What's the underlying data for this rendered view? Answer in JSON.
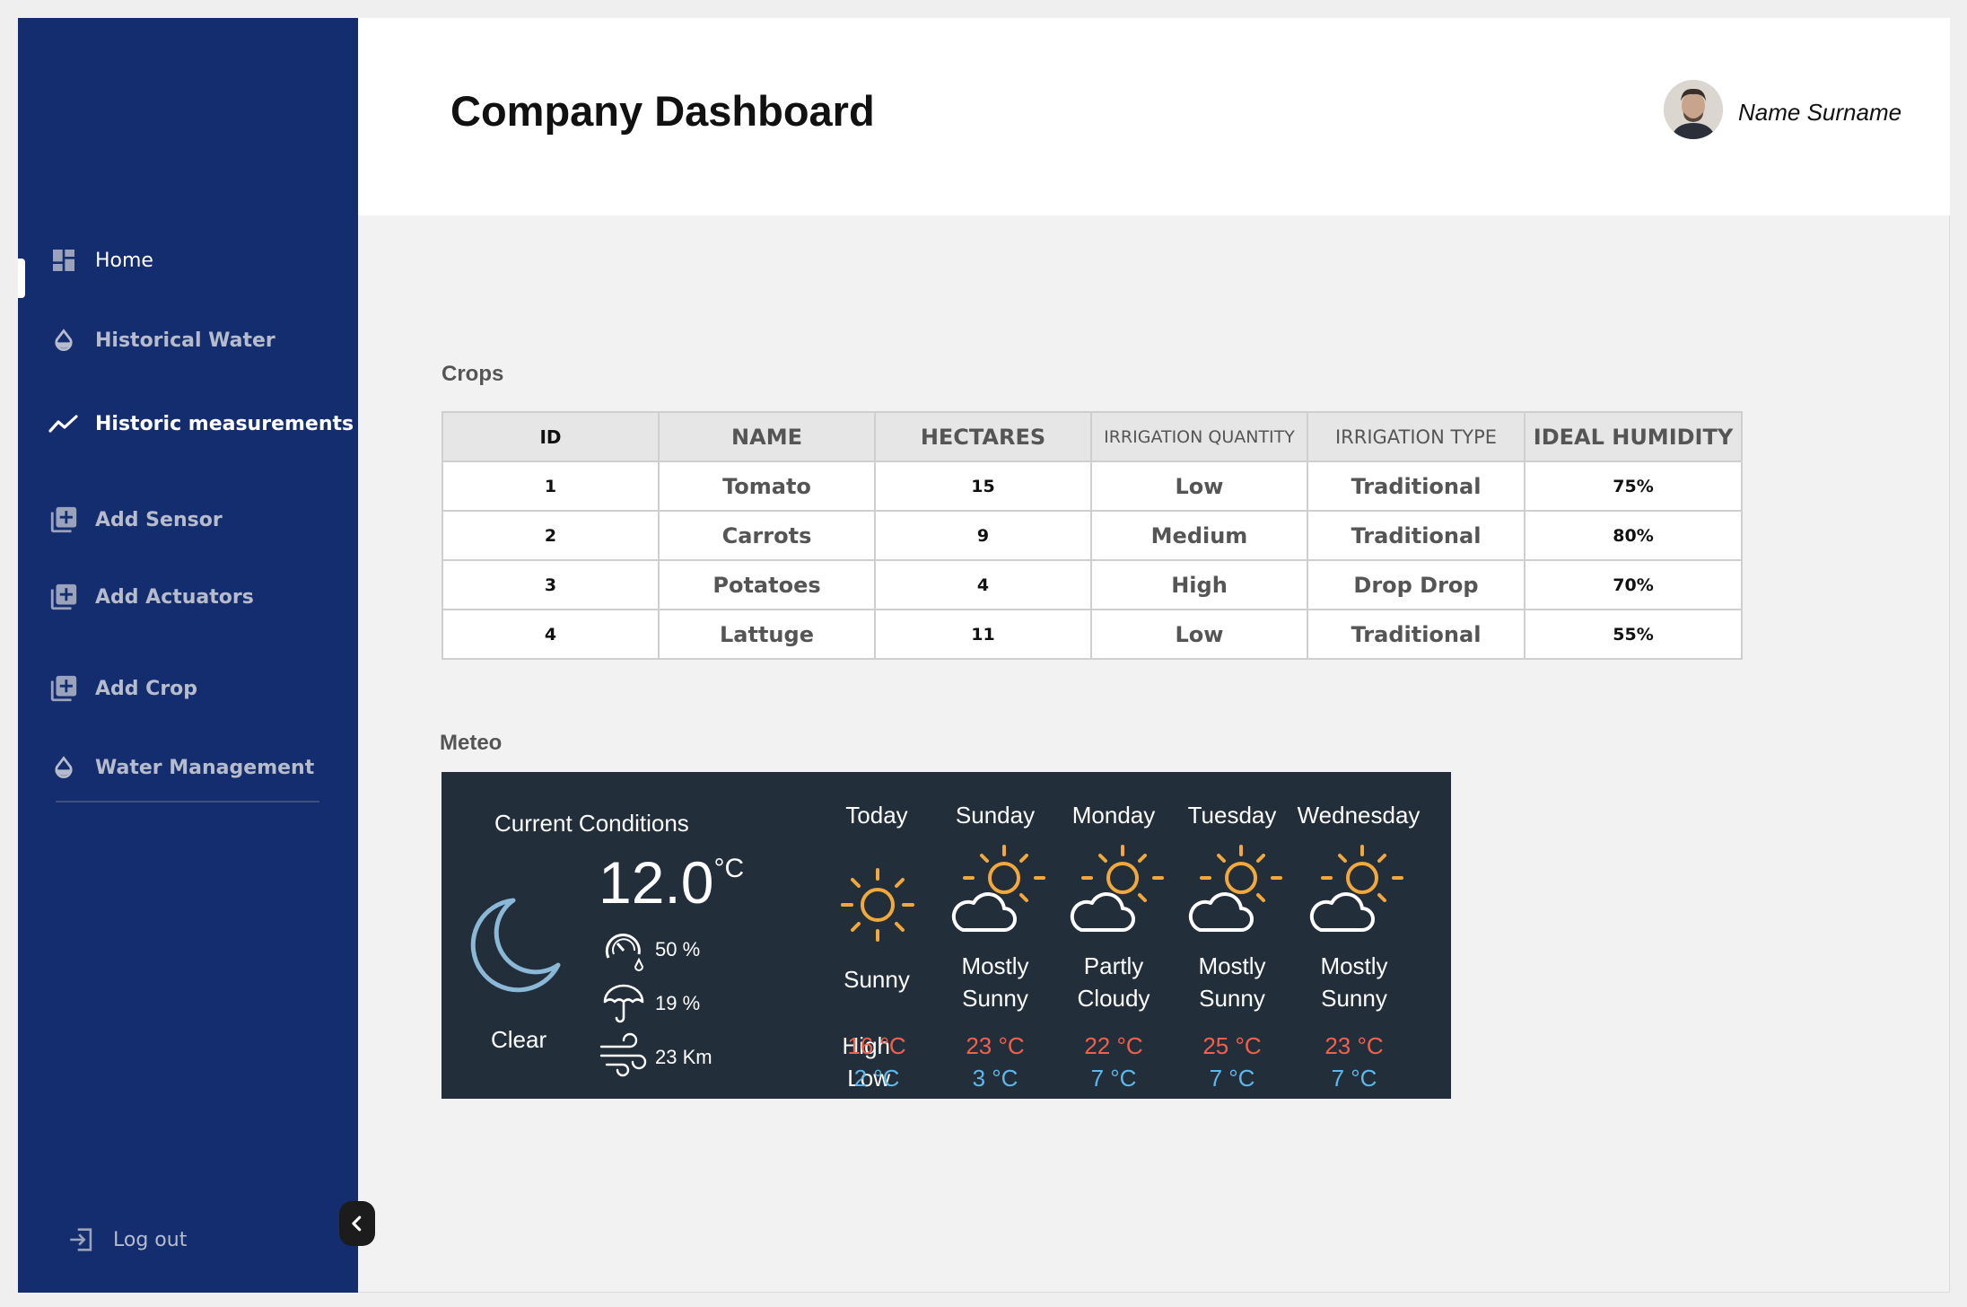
{
  "header": {
    "title": "Company Dashboard",
    "user_name": "Name Surname"
  },
  "sidebar": {
    "items": [
      {
        "label": "Home",
        "icon": "dashboard-icon",
        "active": true
      },
      {
        "label": "Historical Water",
        "icon": "water-drop-icon"
      },
      {
        "label": "Historic measurements",
        "icon": "line-chart-icon"
      },
      {
        "label": "Add Sensor",
        "icon": "add-box-icon"
      },
      {
        "label": "Add Actuators",
        "icon": "add-box-icon"
      },
      {
        "label": "Add Crop",
        "icon": "add-box-icon"
      },
      {
        "label": "Water Management",
        "icon": "water-drop-icon"
      }
    ],
    "logout_label": "Log out"
  },
  "crops": {
    "section_label": "Crops",
    "columns": [
      "ID",
      "NAME",
      "HECTARES",
      "IRRIGATION QUANTITY",
      "IRRIGATION TYPE",
      "IDEAL HUMIDITY"
    ],
    "rows": [
      [
        "1",
        "Tomato",
        "15",
        "Low",
        "Traditional",
        "75%"
      ],
      [
        "2",
        "Carrots",
        "9",
        "Medium",
        "Traditional",
        "80%"
      ],
      [
        "3",
        "Potatoes",
        "4",
        "High",
        "Drop Drop",
        "70%"
      ],
      [
        "4",
        "Lattuge",
        "11",
        "Low",
        "Traditional",
        "55%"
      ]
    ]
  },
  "meteo": {
    "section_label": "Meteo",
    "current": {
      "title": "Current Conditions",
      "temp": "12.0",
      "unit": "°C",
      "condition": "Clear",
      "humidity": "50 %",
      "rain": "19 %",
      "wind": "23 Km"
    },
    "high_label": "High",
    "low_label": "Low",
    "forecast": [
      {
        "day": "Today",
        "cond1": "Sunny",
        "cond2": "",
        "high": "16 °C",
        "low": "2 °C",
        "icon": "sun-icon"
      },
      {
        "day": "Sunday",
        "cond1": "Mostly",
        "cond2": "Sunny",
        "high": "23 °C",
        "low": "3 °C",
        "icon": "sun-cloud-icon"
      },
      {
        "day": "Monday",
        "cond1": "Partly",
        "cond2": "Cloudy",
        "high": "22 °C",
        "low": "7 °C",
        "icon": "sun-cloud-icon"
      },
      {
        "day": "Tuesday",
        "cond1": "Mostly",
        "cond2": "Sunny",
        "high": "25 °C",
        "low": "7 °C",
        "icon": "sun-cloud-icon"
      },
      {
        "day": "Wednesday",
        "cond1": "Mostly",
        "cond2": "Sunny",
        "high": "23 °C",
        "low": "7 °C",
        "icon": "sun-cloud-icon"
      }
    ],
    "colors": {
      "high": "#f0614c",
      "low": "#5fb7ea",
      "sun": "#f2a83b",
      "moon": "#8ab8d6"
    }
  }
}
